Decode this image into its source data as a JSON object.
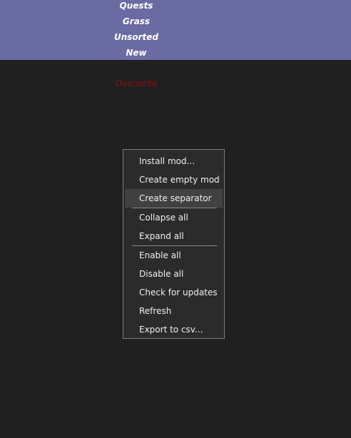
{
  "mod_list": {
    "separators": [
      "Quests",
      "Grass",
      "Unsorted",
      "New"
    ],
    "overwrite_label": "Overwrite"
  },
  "context_menu": {
    "items": [
      "Install mod...",
      "Create empty mod",
      "Create separator",
      "Collapse all",
      "Expand all",
      "Enable all",
      "Disable all",
      "Check for updates",
      "Refresh",
      "Export to csv..."
    ],
    "highlighted_item": "Create separator"
  },
  "colors": {
    "background": "#202020",
    "separator_band": "#6b6ba3",
    "overwrite_text": "#8c0f0f",
    "menu_background": "#2b2b2b",
    "menu_highlight": "#414141"
  }
}
